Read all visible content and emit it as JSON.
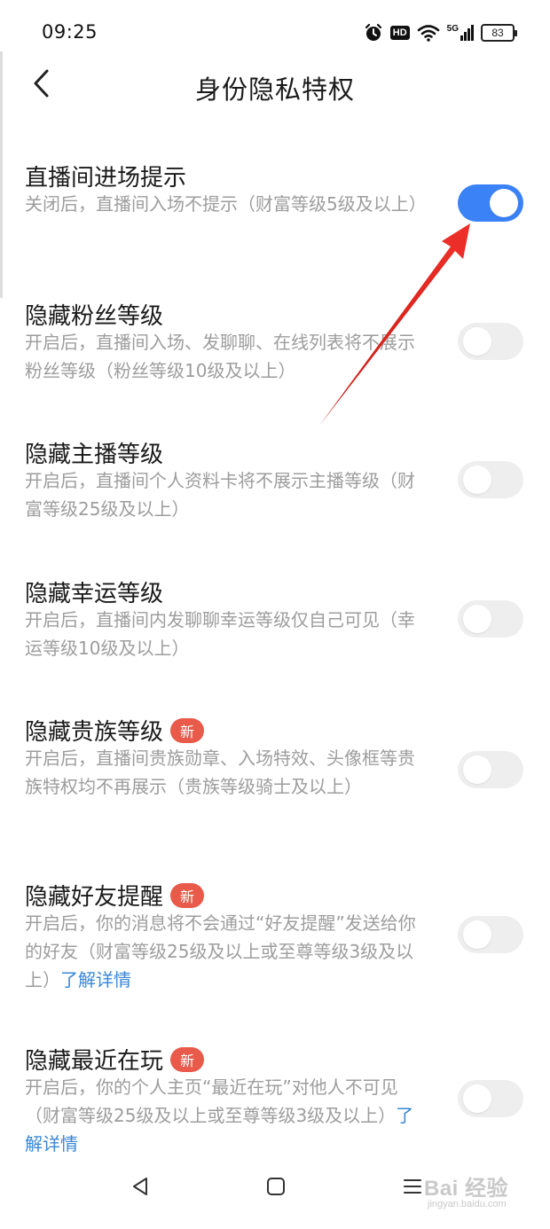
{
  "status_bar": {
    "time": "09:25",
    "hd_label": "HD",
    "network_label": "5G",
    "battery_level": "83",
    "icons": [
      "alarm-icon",
      "hd-icon",
      "wifi-icon",
      "signal-5g-icon",
      "battery-icon"
    ]
  },
  "header": {
    "title": "身份隐私特权",
    "back_icon": "chevron-left-icon"
  },
  "settings": [
    {
      "title": "直播间进场提示",
      "desc": "关闭后，直播间入场不提示（财富等级5级及以上）",
      "enabled": true
    },
    {
      "title": "隐藏粉丝等级",
      "desc": "开启后，直播间入场、发聊聊、在线列表将不展示粉丝等级（粉丝等级10级及以上）",
      "enabled": false
    },
    {
      "title": "隐藏主播等级",
      "desc": "开启后，直播间个人资料卡将不展示主播等级（财富等级25级及以上）",
      "enabled": false
    },
    {
      "title": "隐藏幸运等级",
      "desc": "开启后，直播间内发聊聊幸运等级仅自己可见（幸运等级10级及以上）",
      "enabled": false
    },
    {
      "title": "隐藏贵族等级",
      "badge": "新",
      "desc": "开启后，直播间贵族勋章、入场特效、头像框等贵族特权均不再展示（贵族等级骑士及以上）",
      "enabled": false
    },
    {
      "title": "隐藏好友提醒",
      "badge": "新",
      "desc": "开启后，你的消息将不会通过“好友提醒”发送给你的好友（财富等级25级及以上或至尊等级3级及以上）",
      "link": "了解详情",
      "enabled": false
    },
    {
      "title": "隐藏最近在玩",
      "badge": "新",
      "desc": "开启后，你的个人主页“最近在玩”对他人不可见（财富等级25级及以上或至尊等级3级及以上）",
      "link": "了解详情",
      "enabled": false
    }
  ],
  "nav_bar": {
    "icons": [
      "back-triangle-icon",
      "home-square-icon",
      "menu-lines-icon"
    ]
  },
  "watermark": {
    "main": "Bai 经验",
    "sub": "jingyan.baidu.com"
  },
  "colors": {
    "accent": "#3b82f6",
    "badge": "#e85a4a",
    "link": "#3a87d6",
    "annotation_arrow": "#e8281e",
    "secondary_text": "#9d9d9d"
  }
}
